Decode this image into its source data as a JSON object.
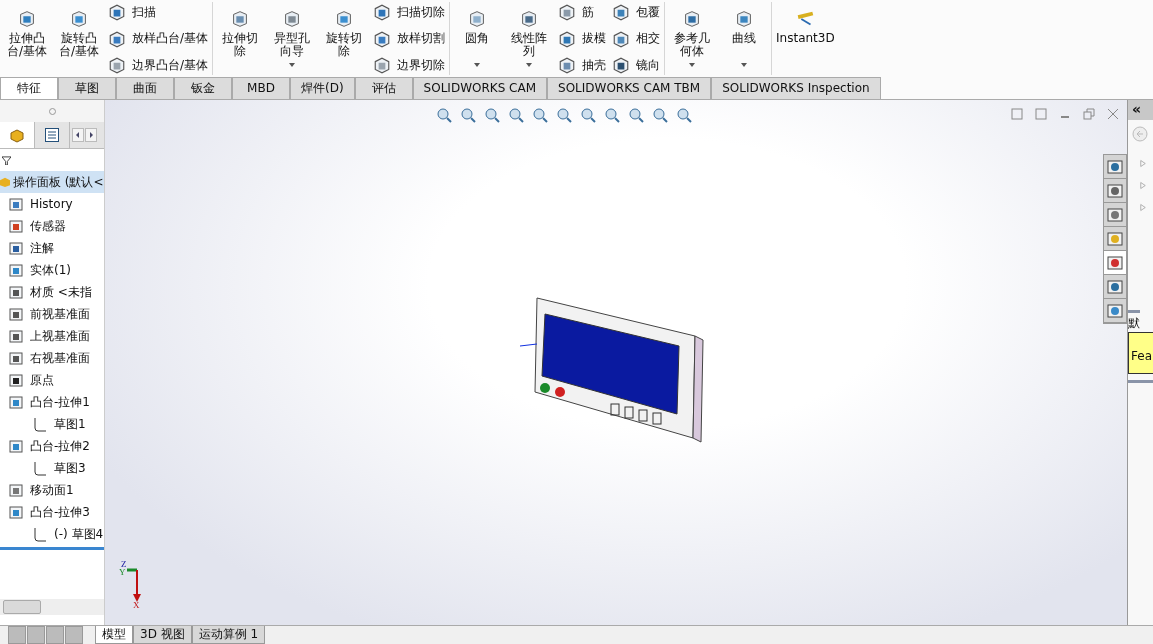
{
  "ribbon": {
    "groups": [
      {
        "large": [
          {
            "label": "拉伸凸台/基体",
            "kind": "extrude",
            "dropdown": false
          },
          {
            "label": "旋转凸台/基体",
            "kind": "revolve",
            "dropdown": false
          }
        ],
        "columns": [
          [
            {
              "label": "扫描",
              "kind": "sweep"
            },
            {
              "label": "放样凸台/基体",
              "kind": "loft"
            },
            {
              "label": "边界凸台/基体",
              "kind": "boundary"
            }
          ]
        ]
      },
      {
        "large": [
          {
            "label": "拉伸切除",
            "kind": "cut",
            "dropdown": false
          },
          {
            "label": "异型孔向导",
            "kind": "hole",
            "dropdown": true
          },
          {
            "label": "旋转切除",
            "kind": "revolve",
            "dropdown": false
          }
        ],
        "columns": [
          [
            {
              "label": "扫描切除",
              "kind": "sweep"
            },
            {
              "label": "放样切割",
              "kind": "loft"
            },
            {
              "label": "边界切除",
              "kind": "boundary"
            }
          ]
        ]
      },
      {
        "large": [
          {
            "label": "圆角",
            "kind": "fillet",
            "dropdown": true
          },
          {
            "label": "线性阵列",
            "kind": "pattern",
            "dropdown": true
          }
        ],
        "columns": [
          [
            {
              "label": "筋",
              "kind": "rib"
            },
            {
              "label": "拔模",
              "kind": "draft"
            },
            {
              "label": "抽壳",
              "kind": "shell"
            }
          ],
          [
            {
              "label": "包覆",
              "kind": "wrap"
            },
            {
              "label": "相交",
              "kind": "intersect"
            },
            {
              "label": "镜向",
              "kind": "mirror"
            }
          ]
        ]
      },
      {
        "large": [
          {
            "label": "参考几何体",
            "kind": "refgeom",
            "dropdown": true
          },
          {
            "label": "曲线",
            "kind": "curve",
            "dropdown": true
          }
        ]
      },
      {
        "large": [
          {
            "label": "Instant3D",
            "kind": "instant3d",
            "dropdown": false
          }
        ]
      }
    ]
  },
  "command_tabs": [
    {
      "label": "特征",
      "selected": true
    },
    {
      "label": "草图",
      "selected": false
    },
    {
      "label": "曲面",
      "selected": false
    },
    {
      "label": "钣金",
      "selected": false
    },
    {
      "label": "MBD",
      "selected": false
    },
    {
      "label": "焊件(D)",
      "selected": false
    },
    {
      "label": "评估",
      "selected": false
    },
    {
      "label": "SOLIDWORKS CAM",
      "selected": false
    },
    {
      "label": "SOLIDWORKS CAM TBM",
      "selected": false
    },
    {
      "label": "SOLIDWORKS Inspection",
      "selected": false
    }
  ],
  "feature_tree": {
    "panel_tabs": [
      {
        "kind": "features",
        "selected": true
      },
      {
        "kind": "properties",
        "selected": false
      }
    ],
    "root": {
      "label": "操作面板  (默认<",
      "selected": true,
      "children": [
        {
          "label": "History",
          "kind": "history",
          "selected": false
        },
        {
          "label": "传感器",
          "kind": "sensor",
          "selected": false
        },
        {
          "label": "注解",
          "kind": "annotation",
          "selected": false
        },
        {
          "label": "实体(1)",
          "kind": "solid",
          "selected": false
        },
        {
          "label": "材质 <未指",
          "kind": "material",
          "selected": false
        },
        {
          "label": "前视基准面",
          "kind": "plane",
          "selected": false
        },
        {
          "label": "上视基准面",
          "kind": "plane",
          "selected": false
        },
        {
          "label": "右视基准面",
          "kind": "plane",
          "selected": false
        },
        {
          "label": "原点",
          "kind": "origin",
          "selected": false
        },
        {
          "label": "凸台-拉伸1",
          "kind": "extrude",
          "selected": false,
          "children": [
            {
              "label": "草图1",
              "kind": "sketch",
              "selected": false
            }
          ]
        },
        {
          "label": "凸台-拉伸2",
          "kind": "extrude",
          "selected": false,
          "children": [
            {
              "label": "草图3",
              "kind": "sketch",
              "selected": false
            }
          ]
        },
        {
          "label": "移动面1",
          "kind": "moveface",
          "selected": false
        },
        {
          "label": "凸台-拉伸3",
          "kind": "extrude",
          "selected": false,
          "children": [
            {
              "label": "(-) 草图4",
              "kind": "sketch",
              "selected": false
            }
          ]
        }
      ]
    }
  },
  "triad": {
    "labels": [
      "Z",
      "Y",
      "X"
    ]
  },
  "task_pane": {
    "tabs": [
      {
        "kind": "home",
        "selected": false
      },
      {
        "kind": "library",
        "selected": false
      },
      {
        "kind": "folder",
        "selected": false
      },
      {
        "kind": "palette",
        "selected": false
      },
      {
        "kind": "appearance",
        "selected": true
      },
      {
        "kind": "properties",
        "selected": false
      },
      {
        "kind": "forum",
        "selected": false
      }
    ],
    "collapse": "«",
    "heading": "默",
    "note": "Fea"
  },
  "bottom_tabs": [
    {
      "label": "模型",
      "selected": true
    },
    {
      "label": "3D 视图",
      "selected": false
    },
    {
      "label": "运动算例 1",
      "selected": false
    }
  ]
}
